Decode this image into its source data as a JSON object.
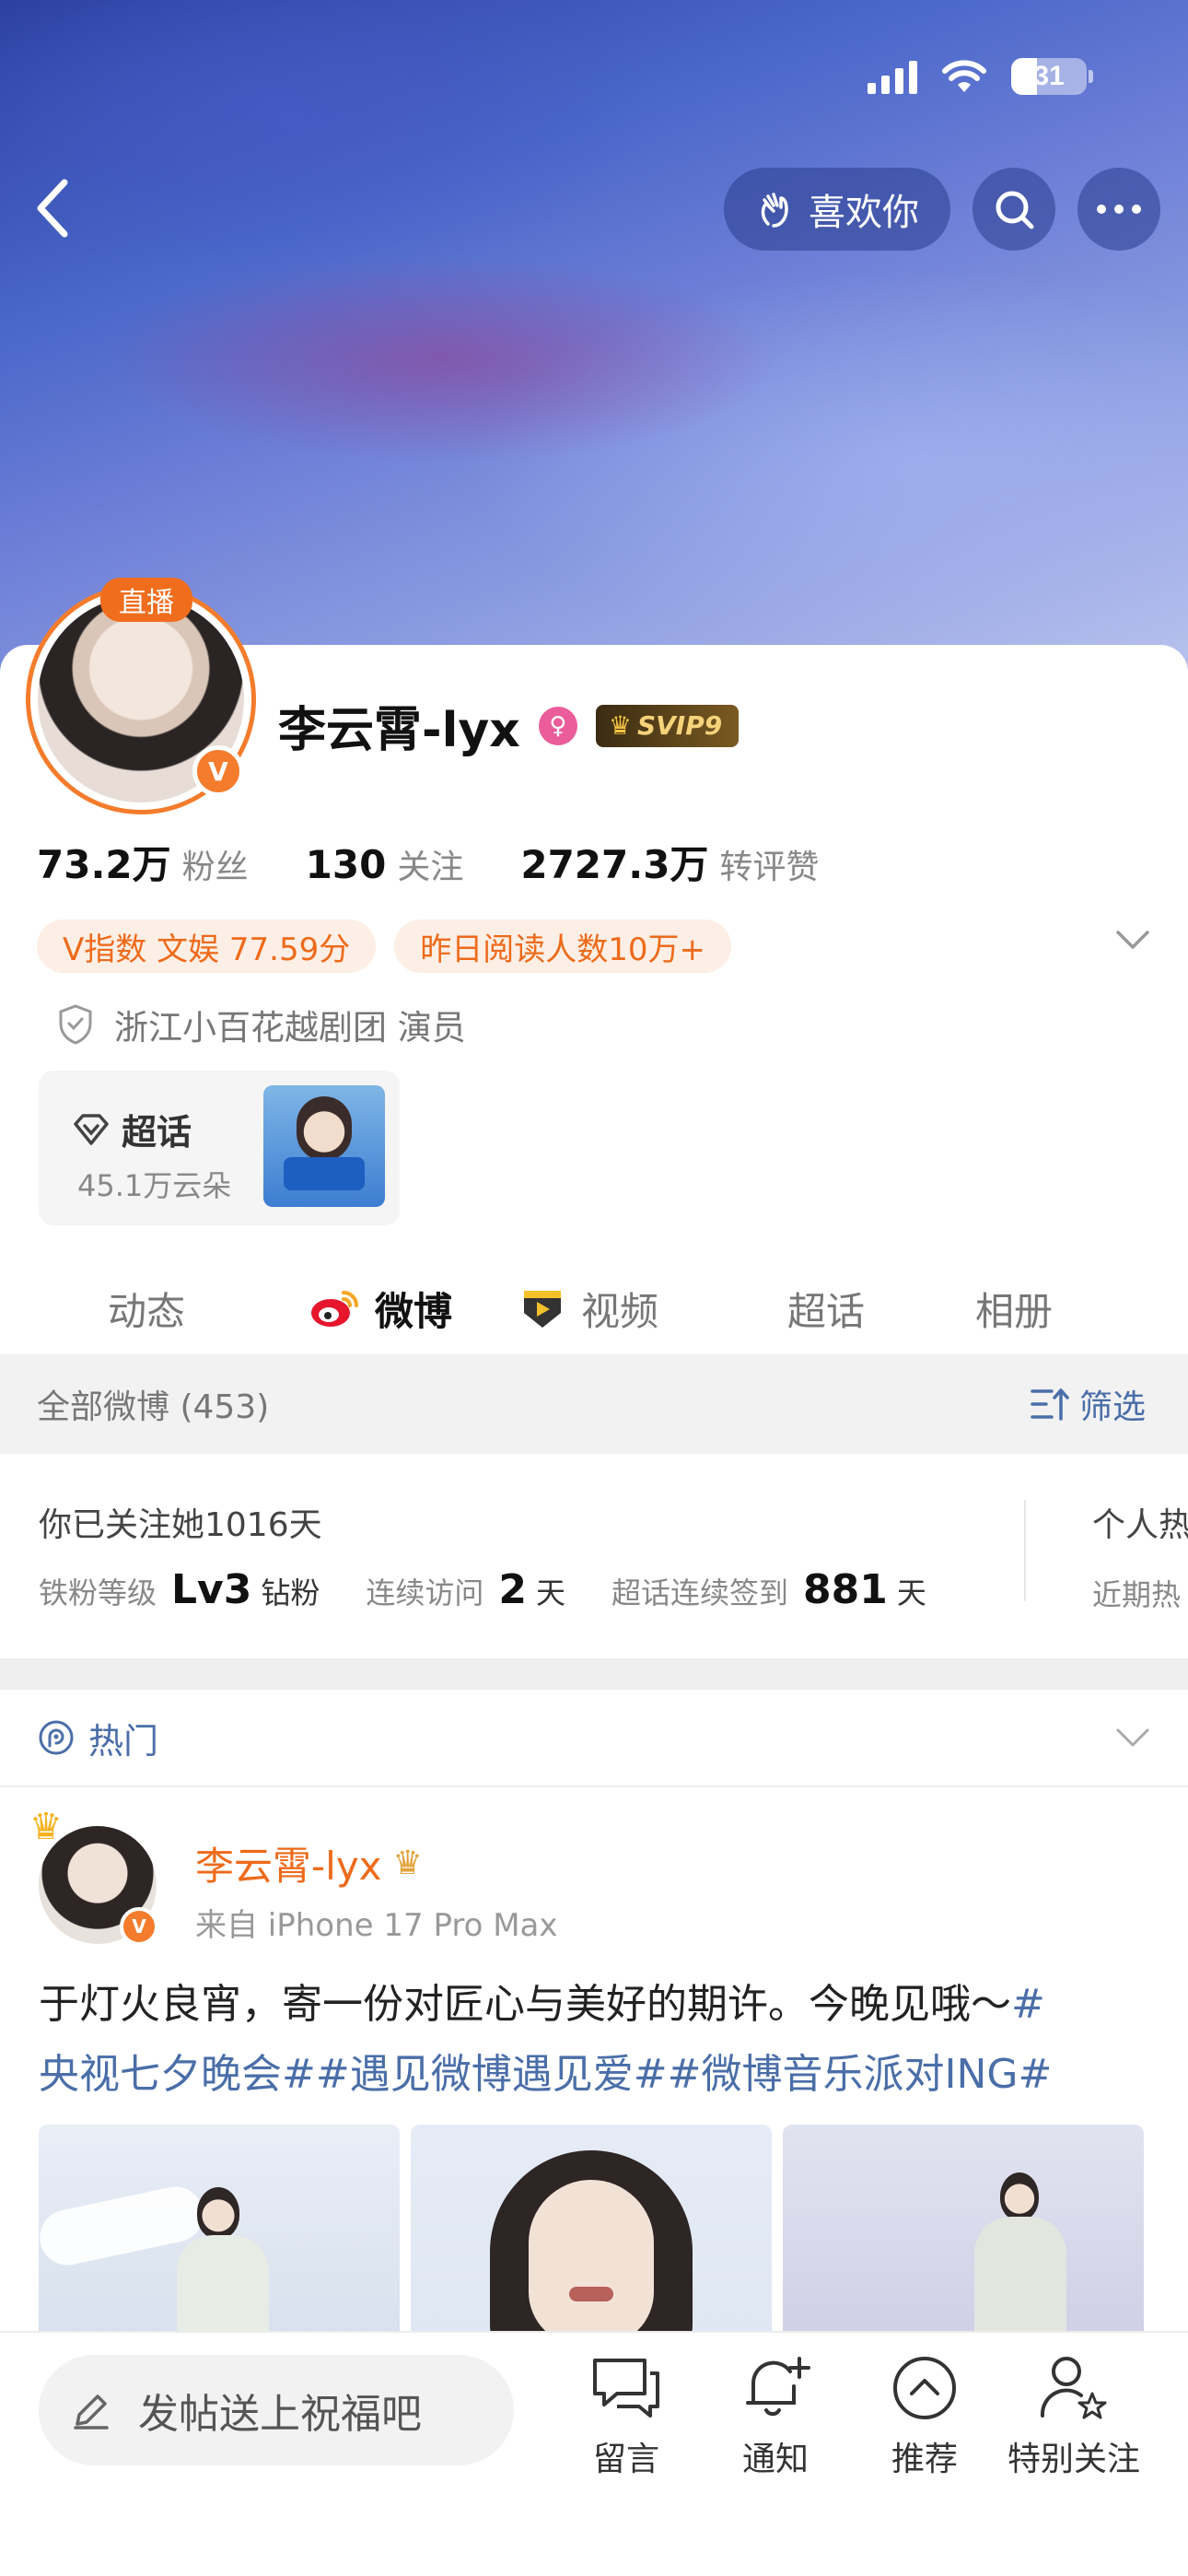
{
  "status_bar": {
    "battery": "31"
  },
  "header": {
    "like_label": "喜欢你"
  },
  "profile": {
    "live_badge": "直播",
    "name": "李云霄-lyx",
    "svip": "SVIP9",
    "stats": [
      {
        "value": "73.2万",
        "label": "粉丝"
      },
      {
        "value": "130",
        "label": "关注"
      },
      {
        "value": "2727.3万",
        "label": "转评赞"
      }
    ],
    "tags": [
      "V指数 文娱 77.59分",
      "昨日阅读人数10万+"
    ],
    "certification": "浙江小百花越剧团 演员",
    "supertopic": {
      "title": "超话",
      "subtitle": "45.1万云朵"
    },
    "tabs": [
      "动态",
      "微博",
      "视频",
      "超话",
      "相册"
    ]
  },
  "filter_bar": {
    "all_label": "全部微博 (453)",
    "filter_label": "筛选"
  },
  "fan_card": {
    "follow_days": "你已关注她1016天",
    "fan_level_label": "铁粉等级",
    "fan_level_value": "Lv3",
    "fan_level_unit": "钻粉",
    "visit_label": "连续访问",
    "visit_value": "2",
    "visit_unit": "天",
    "checkin_label": "超话连续签到",
    "checkin_value": "881",
    "checkin_unit": "天",
    "peek_title": "个人热",
    "peek_sub": "近期热"
  },
  "hot_section": {
    "label": "热门"
  },
  "post": {
    "author": "李云霄-lyx",
    "source": "来自 iPhone 17 Pro Max",
    "text_plain": "于灯火良宵，寄一份对匠心与美好的期许。今晚见哦～",
    "topic_1a": "#",
    "topic_1b": "央视七夕晚会#",
    "topic_2": "#遇见微博遇见爱#",
    "topic_3": "#微博音乐派对ING#"
  },
  "bottom_bar": {
    "compose_placeholder": "发帖送上祝福吧",
    "actions": [
      "留言",
      "通知",
      "推荐",
      "特别关注"
    ]
  },
  "colors": {
    "accent": "#f06d1d",
    "link": "#4a6ea8"
  }
}
